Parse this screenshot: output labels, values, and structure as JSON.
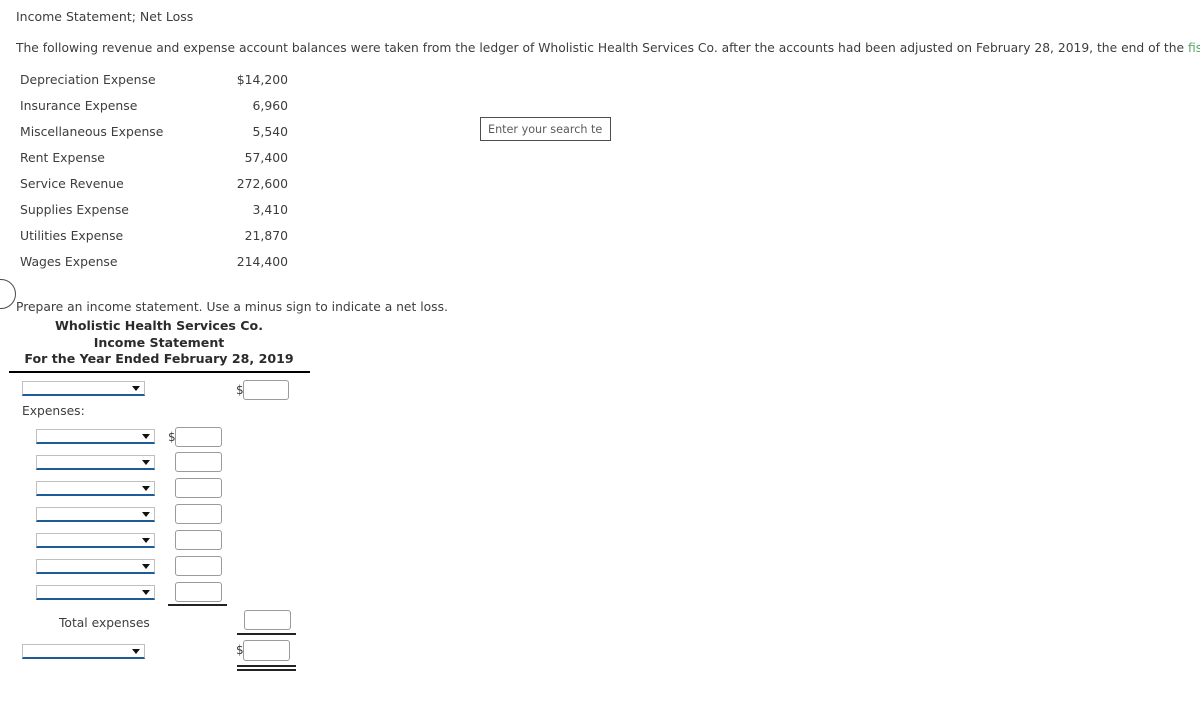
{
  "problem": {
    "title": "Income Statement; Net Loss",
    "statement_prefix": "The following revenue and expense account balances were taken from the ledger of Wholistic Health Services Co. after the accounts had been adjusted on February 28, 2019, the end of the ",
    "statement_link": "fiscal year:",
    "link_color": "#5aa469",
    "instruction": "Prepare an income statement. Use a minus sign to indicate a net loss."
  },
  "search": {
    "placeholder": "Enter your search term",
    "value": ""
  },
  "balances": {
    "rows": [
      {
        "account": "Depreciation Expense",
        "amount": "$14,200"
      },
      {
        "account": "Insurance Expense",
        "amount": "6,960"
      },
      {
        "account": "Miscellaneous Expense",
        "amount": "5,540"
      },
      {
        "account": "Rent Expense",
        "amount": "57,400"
      },
      {
        "account": "Service Revenue",
        "amount": "272,600"
      },
      {
        "account": "Supplies Expense",
        "amount": "3,410"
      },
      {
        "account": "Utilities Expense",
        "amount": "21,870"
      },
      {
        "account": "Wages Expense",
        "amount": "214,400"
      }
    ]
  },
  "statement": {
    "company": "Wholistic Health Services Co.",
    "title": "Income Statement",
    "period": "For the Year Ended February 28, 2019",
    "expenses_label": "Expenses:",
    "total_expenses_label": "Total expenses",
    "dollar_sign": "$",
    "revenue_row": {
      "select_value": "",
      "amount_value": ""
    },
    "expense_rows": [
      {
        "select_value": "",
        "amount_value": ""
      },
      {
        "select_value": "",
        "amount_value": ""
      },
      {
        "select_value": "",
        "amount_value": ""
      },
      {
        "select_value": "",
        "amount_value": ""
      },
      {
        "select_value": "",
        "amount_value": ""
      },
      {
        "select_value": "",
        "amount_value": ""
      },
      {
        "select_value": "",
        "amount_value": ""
      }
    ],
    "total_expenses_row": {
      "amount_value": ""
    },
    "net_row": {
      "select_value": "",
      "amount_value": ""
    }
  }
}
